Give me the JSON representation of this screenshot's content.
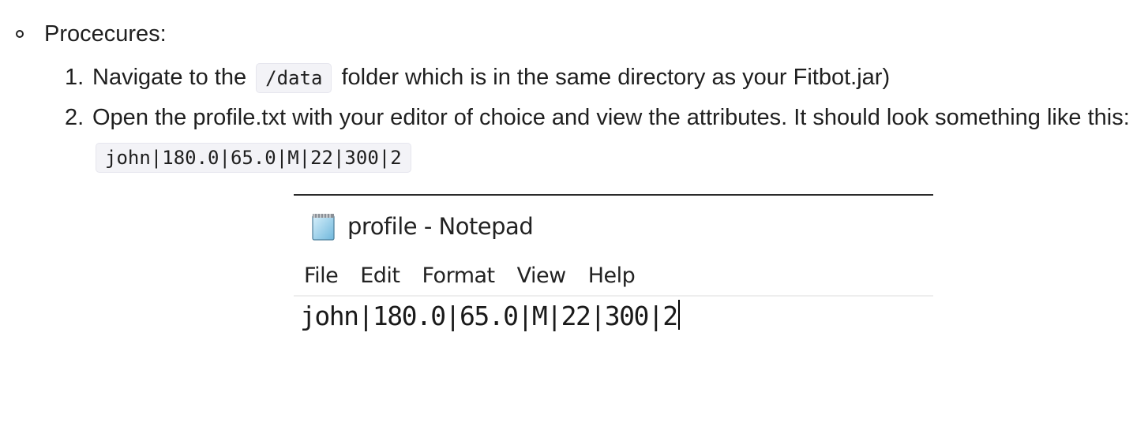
{
  "procedures": {
    "heading": "Procecures:",
    "steps": [
      {
        "number": "1.",
        "text_before": "Navigate to the",
        "code": "/data",
        "text_after": "folder which is in the same directory as your Fitbot.jar)"
      },
      {
        "number": "2.",
        "text_before": "Open the profile.txt with your editor of choice and view the attributes. It should look something like this:",
        "code": "john|180.0|65.0|M|22|300|2"
      }
    ]
  },
  "notepad": {
    "title": "profile - Notepad",
    "icon": "notepad-icon",
    "menu": [
      "File",
      "Edit",
      "Format",
      "View",
      "Help"
    ],
    "content": "john|180.0|65.0|M|22|300|2"
  }
}
